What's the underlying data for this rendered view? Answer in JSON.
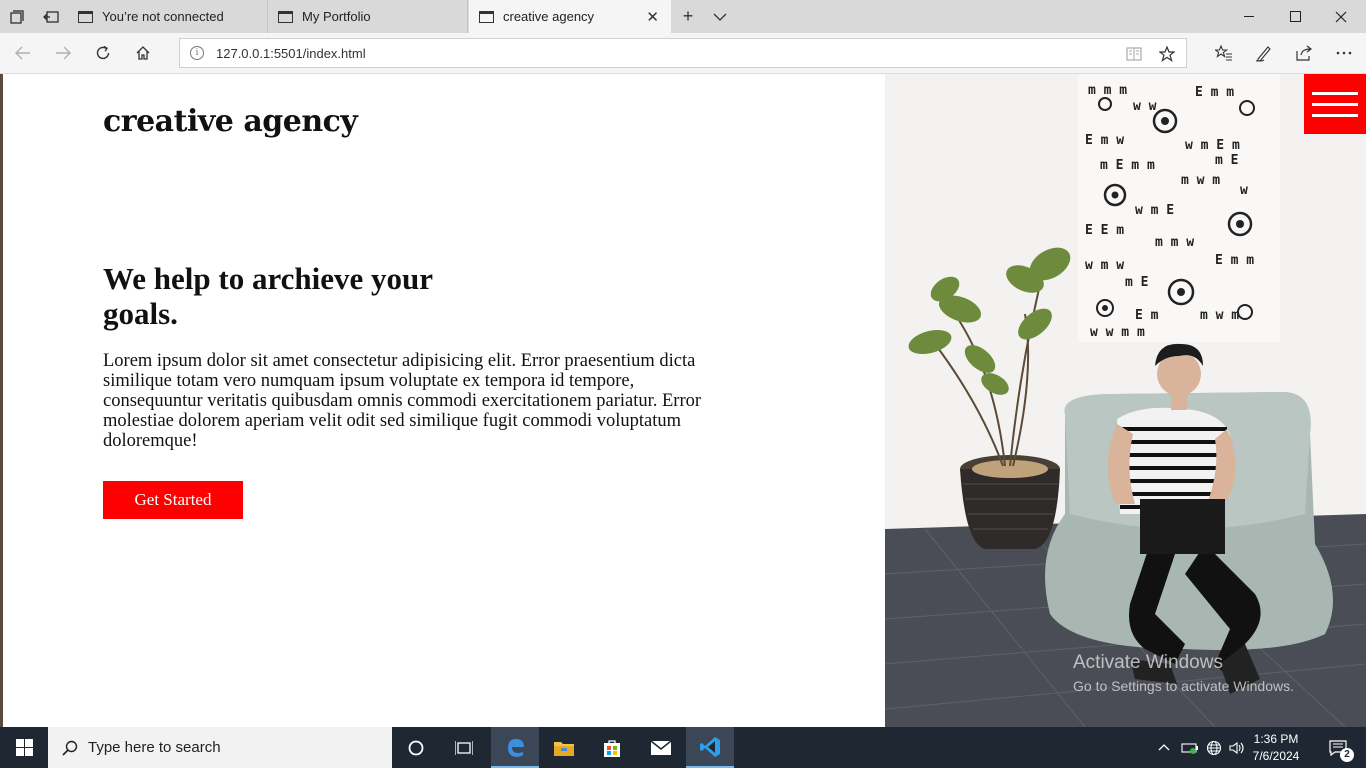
{
  "browser": {
    "tabs": [
      {
        "label": "You’re not connected",
        "active": false
      },
      {
        "label": "My Portfolio",
        "active": false
      },
      {
        "label": "creative agency",
        "active": true
      }
    ],
    "address": "127.0.0.1:5501/index.html"
  },
  "page": {
    "logo": "creative agency",
    "headline": "We help to archieve your goals.",
    "body": "Lorem ipsum dolor sit amet consectetur adipisicing elit. Error praesentium dicta similique totam vero numquam ipsum voluptate ex tempora id tempore, consequuntur veritatis quibusdam omnis commodi exercitationem pariatur. Error molestiae dolorem aperiam velit odit sed similique fugit commodi voluptatum doloremque!",
    "cta_label": "Get Started",
    "accent_color": "#ff0000"
  },
  "watermark": {
    "line1": "Activate Windows",
    "line2": "Go to Settings to activate Windows."
  },
  "taskbar": {
    "search_placeholder": "Type here to search",
    "time": "1:36 PM",
    "date": "7/6/2024",
    "notification_count": "2",
    "apps": [
      "cortana-icon",
      "task-view-icon",
      "edge-icon",
      "file-explorer-icon",
      "store-icon",
      "mail-icon",
      "vscode-icon"
    ]
  }
}
